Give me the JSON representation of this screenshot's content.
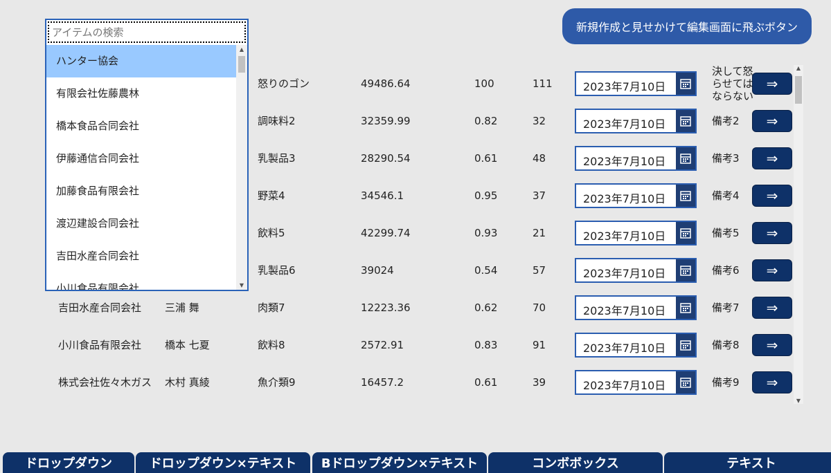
{
  "header": {
    "new_button_label": "新規作成と見せかけて編集画面に飛ぶボタン"
  },
  "combo": {
    "placeholder": "アイテムの検索",
    "items": [
      "ハンター協会",
      "有限会社佐藤農林",
      "橋本食品合同会社",
      "伊藤通信合同会社",
      "加藤食品有限会社",
      "渡辺建設合同会社",
      "吉田水産合同会社",
      "小川食品有限会社"
    ],
    "selected_index": 0
  },
  "grid": {
    "arrow_label": "⇒",
    "rows": [
      {
        "company": "",
        "person": "",
        "product": "怒りのゴン",
        "amount": "49486.64",
        "rate": "100",
        "qty": "111",
        "date": "2023年7月10日",
        "note": "決して怒らせてはならない"
      },
      {
        "company": "",
        "person": "",
        "product": "調味料2",
        "amount": "32359.99",
        "rate": "0.82",
        "qty": "32",
        "date": "2023年7月10日",
        "note": "備考2"
      },
      {
        "company": "",
        "person": "",
        "product": "乳製品3",
        "amount": "28290.54",
        "rate": "0.61",
        "qty": "48",
        "date": "2023年7月10日",
        "note": "備考3"
      },
      {
        "company": "",
        "person": "",
        "product": "野菜4",
        "amount": "34546.1",
        "rate": "0.95",
        "qty": "37",
        "date": "2023年7月10日",
        "note": "備考4"
      },
      {
        "company": "",
        "person": "",
        "product": "飲料5",
        "amount": "42299.74",
        "rate": "0.93",
        "qty": "21",
        "date": "2023年7月10日",
        "note": "備考5"
      },
      {
        "company": "",
        "person": "",
        "product": "乳製品6",
        "amount": "39024",
        "rate": "0.54",
        "qty": "57",
        "date": "2023年7月10日",
        "note": "備考6"
      },
      {
        "company": "吉田水産合同会社",
        "person": "三浦 舞",
        "product": "肉類7",
        "amount": "12223.36",
        "rate": "0.62",
        "qty": "70",
        "date": "2023年7月10日",
        "note": "備考7"
      },
      {
        "company": "小川食品有限会社",
        "person": "橋本 七夏",
        "product": "飲料8",
        "amount": "2572.91",
        "rate": "0.83",
        "qty": "91",
        "date": "2023年7月10日",
        "note": "備考8"
      },
      {
        "company": "株式会社佐々木ガス",
        "person": "木村 真綾",
        "product": "魚介類9",
        "amount": "16457.2",
        "rate": "0.61",
        "qty": "39",
        "date": "2023年7月10日",
        "note": "備考9"
      }
    ]
  },
  "tabs": [
    {
      "label": "ドロップダウン"
    },
    {
      "label": "ドロップダウン×テキスト"
    },
    {
      "label": "Bドロップダウン×テキスト"
    },
    {
      "label": "コンボボックス"
    },
    {
      "label": "テキスト"
    }
  ],
  "colors": {
    "accent": "#0e3168",
    "button_blue": "#2e5aa8",
    "selected_item": "#99c9ff",
    "background": "#e8e8e8"
  }
}
